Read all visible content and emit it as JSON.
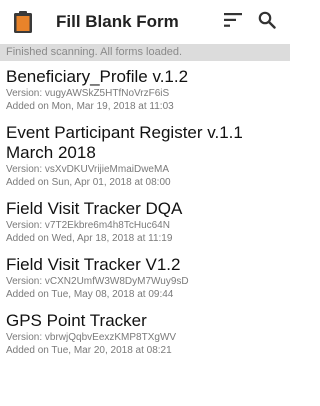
{
  "toolbar": {
    "title": "Fill Blank Form",
    "app_icon": "clipboard-icon",
    "sort_icon": "sort-icon",
    "search_icon": "search-icon"
  },
  "status": {
    "message": "Finished scanning. All forms loaded."
  },
  "forms": [
    {
      "name": "Beneficiary_Profile v.1.2",
      "version": "Version: vugyAWSkZ5HTfNoVrzF6iS",
      "added": "Added on Mon, Mar 19, 2018 at 11:03"
    },
    {
      "name": "Event Participant Register v.1.1 March 2018",
      "version": "Version: vsXvDKUVrijieMmaiDweMA",
      "added": "Added on Sun, Apr 01, 2018 at 08:00"
    },
    {
      "name": "Field Visit Tracker DQA",
      "version": "Version: v7T2Ekbre6m4h8TcHuc64N",
      "added": "Added on Wed, Apr 18, 2018 at 11:19"
    },
    {
      "name": "Field Visit Tracker V1.2",
      "version": "Version: vCXN2UmfW3W8DyM7Wuy9sD",
      "added": "Added on Tue, May 08, 2018 at 09:44"
    },
    {
      "name": "GPS Point Tracker",
      "version": "Version: vbrwjQqbvEexzKMP8TXgWV",
      "added": "Added on Tue, Mar 20, 2018 at 08:21"
    }
  ],
  "colors": {
    "icon_orange": "#e8832a",
    "icon_dark": "#3a3a3a",
    "status_bg": "#dcdcdc"
  }
}
